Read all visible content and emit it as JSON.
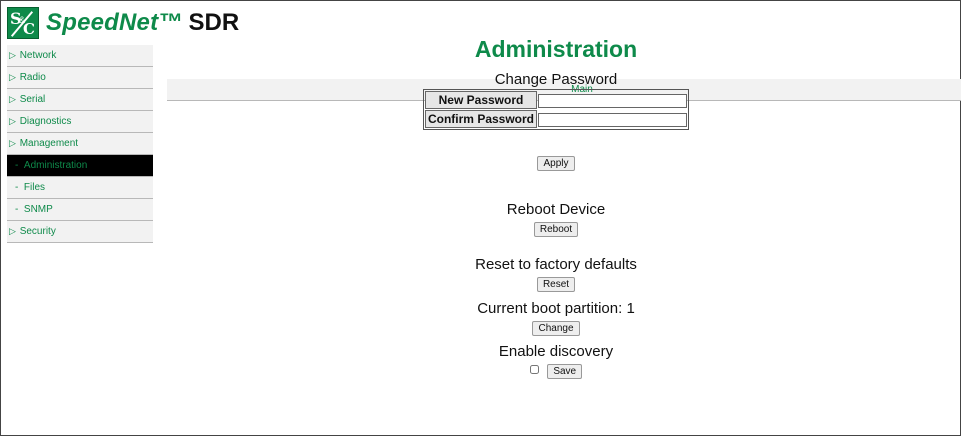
{
  "header": {
    "brand": "SpeedNet™",
    "product": "SDR",
    "logo_icon": "sc-logo-icon"
  },
  "sidebar": {
    "items": [
      {
        "label": "Main"
      },
      {
        "label": "Network",
        "prefix": "▷"
      },
      {
        "label": "Radio",
        "prefix": "▷"
      },
      {
        "label": "Serial",
        "prefix": "▷"
      },
      {
        "label": "Diagnostics",
        "prefix": "▷"
      },
      {
        "label": "Management",
        "prefix": "▷"
      },
      {
        "label": "Administration",
        "prefix": "-",
        "active": true
      },
      {
        "label": "Files",
        "prefix": "-"
      },
      {
        "label": "SNMP",
        "prefix": "-"
      },
      {
        "label": "Security",
        "prefix": "▷"
      }
    ]
  },
  "main": {
    "title": "Administration",
    "change_password": {
      "title": "Change Password",
      "new_label": "New Password",
      "new_value": "",
      "confirm_label": "Confirm Password",
      "confirm_value": "",
      "apply_label": "Apply"
    },
    "reboot": {
      "title": "Reboot Device",
      "button": "Reboot"
    },
    "reset": {
      "title": "Reset to factory defaults",
      "button": "Reset"
    },
    "boot_partition": {
      "title": "Current boot partition: 1",
      "button": "Change"
    },
    "discovery": {
      "title": "Enable discovery",
      "checked": false,
      "button": "Save"
    }
  },
  "colors": {
    "brand_green": "#0e8a4a",
    "active_bg": "#000000",
    "nav_bg": "#f2f2f2"
  }
}
